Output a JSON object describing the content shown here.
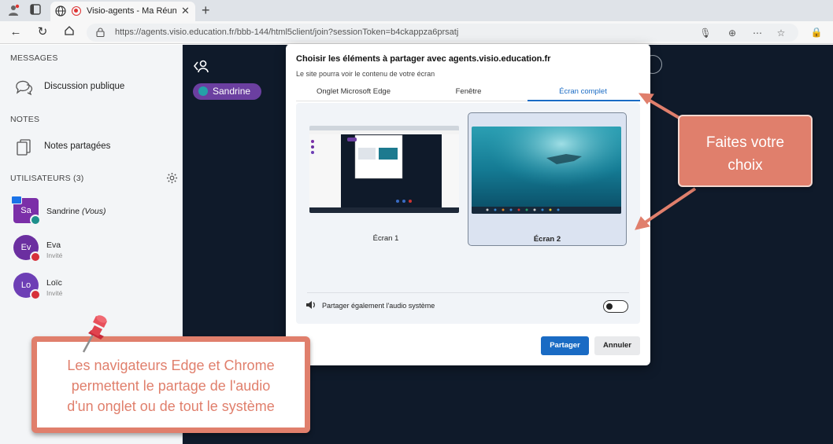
{
  "browser": {
    "tab_title": "Visio-agents - Ma Réunion -",
    "url": "https://agents.visio.education.fr/bbb-144/html5client/join?sessionToken=b4ckappza6prsatj"
  },
  "sidebar": {
    "messages_heading": "MESSAGES",
    "public_chat_label": "Discussion publique",
    "notes_heading": "NOTES",
    "shared_notes_label": "Notes partagées",
    "users_heading": "UTILISATEURS (3)",
    "users": [
      {
        "initials": "Sa",
        "name": "Sandrine (Vous)",
        "role": "",
        "color": "#7b2fa8"
      },
      {
        "initials": "Ev",
        "name": "Eva",
        "role": "Invité",
        "color": "#6b2fa0"
      },
      {
        "initials": "Lo",
        "name": "Loïc",
        "role": "Invité",
        "color": "#6d3fb5"
      }
    ]
  },
  "main": {
    "presenter_name": "Sandrine"
  },
  "dialog": {
    "title": "Choisir les éléments à partager avec agents.visio.education.fr",
    "subtitle": "Le site pourra voir le contenu de votre écran",
    "tabs": [
      "Onglet Microsoft Edge",
      "Fenêtre",
      "Écran complet"
    ],
    "active_tab": "Écran complet",
    "screens": [
      {
        "label": "Écran 1",
        "selected": false
      },
      {
        "label": "Écran 2",
        "selected": true
      }
    ],
    "audio_label": "Partager également l'audio système",
    "audio_enabled": false,
    "share_button": "Partager",
    "cancel_button": "Annuler"
  },
  "annotations": {
    "right_callout_line1": "Faites votre",
    "right_callout_line2": "choix",
    "bottom_callout_line1": "Les navigateurs Edge et Chrome",
    "bottom_callout_line2": "permettent le partage de l'audio",
    "bottom_callout_line3": "d'un onglet ou de tout le système"
  },
  "colors": {
    "accent_blue": "#1a6bc4",
    "callout": "#e07f6c",
    "main_bg": "#0f1a2a",
    "presenter_pill": "#6b3fa0"
  }
}
